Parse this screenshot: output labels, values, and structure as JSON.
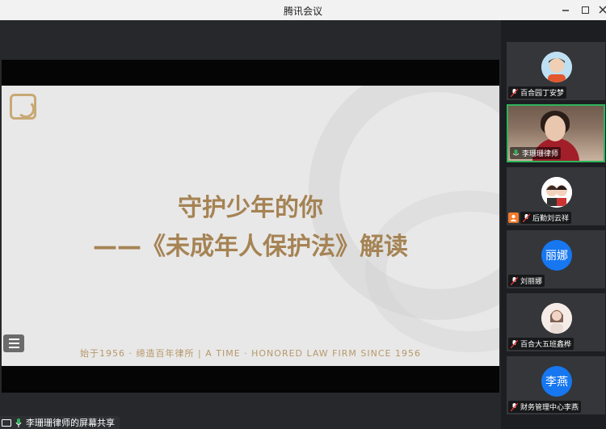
{
  "window": {
    "title": "腾讯会议"
  },
  "slide": {
    "title_line1": "守护少年的你",
    "title_line2": "——《未成年人保护法》解读",
    "footer": "始于1956 · 缔造百年律所  |  A TIME · HONORED LAW FIRM SINCE 1956"
  },
  "share_status": {
    "label": "李珊珊律师的屏幕共享"
  },
  "participants": [
    {
      "name": "百合园丁安梦",
      "mic": "muted",
      "avatar": "photo"
    },
    {
      "name": "李珊珊律师",
      "mic": "active",
      "avatar": "video"
    },
    {
      "name": "后勤刘云祥",
      "mic": "muted",
      "avatar": "cartoon",
      "host": true
    },
    {
      "name": "刘丽娜",
      "mic": "muted",
      "avatar_text": "丽娜"
    },
    {
      "name": "百合大五班鑫桦",
      "mic": "muted",
      "avatar": "photo"
    },
    {
      "name": "财务管理中心李燕",
      "mic": "muted",
      "avatar_text": "李燕"
    }
  ],
  "colors": {
    "accent_gold": "#a58354",
    "avatar_blue": "#1677f0",
    "active_border": "#2fb45a"
  }
}
